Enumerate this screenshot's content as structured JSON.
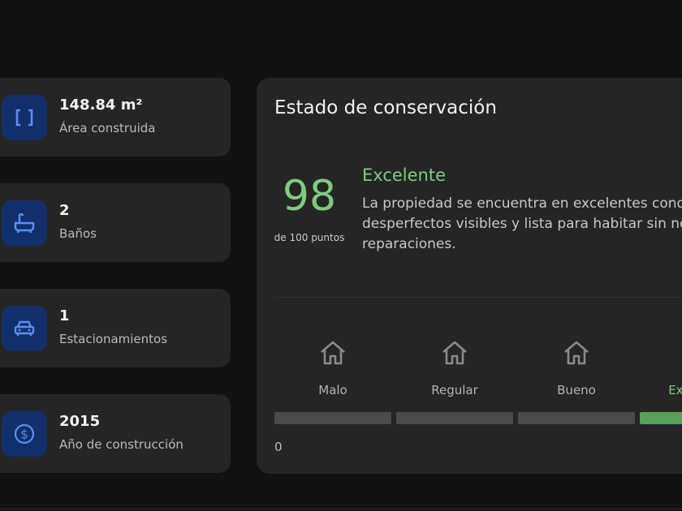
{
  "stats": [
    {
      "value": "148.84 m²",
      "label": "Área construida",
      "icon": "area-icon"
    },
    {
      "value": "2",
      "label": "Baños",
      "icon": "bathtub-icon"
    },
    {
      "value": "1",
      "label": "Estacionamientos",
      "icon": "car-icon"
    },
    {
      "value": "2015",
      "label": "Año de construcción",
      "icon": "dollar-coin-icon"
    }
  ],
  "conservation": {
    "title": "Estado de conservación",
    "score": "98",
    "score_caption": "de 100 puntos",
    "rating": "Excelente",
    "description": "La propiedad se encuentra en excelentes condiciones, sin desperfectos visibles y lista para habitar sin necesidad de reparaciones.",
    "scale": [
      "Malo",
      "Regular",
      "Bueno",
      "Excelente"
    ],
    "active_level": "Excelente",
    "min_label": "0"
  },
  "colors": {
    "accent_green": "#7fca7f",
    "icon_bg": "#11306b",
    "icon_fg": "#5b8ff0"
  }
}
